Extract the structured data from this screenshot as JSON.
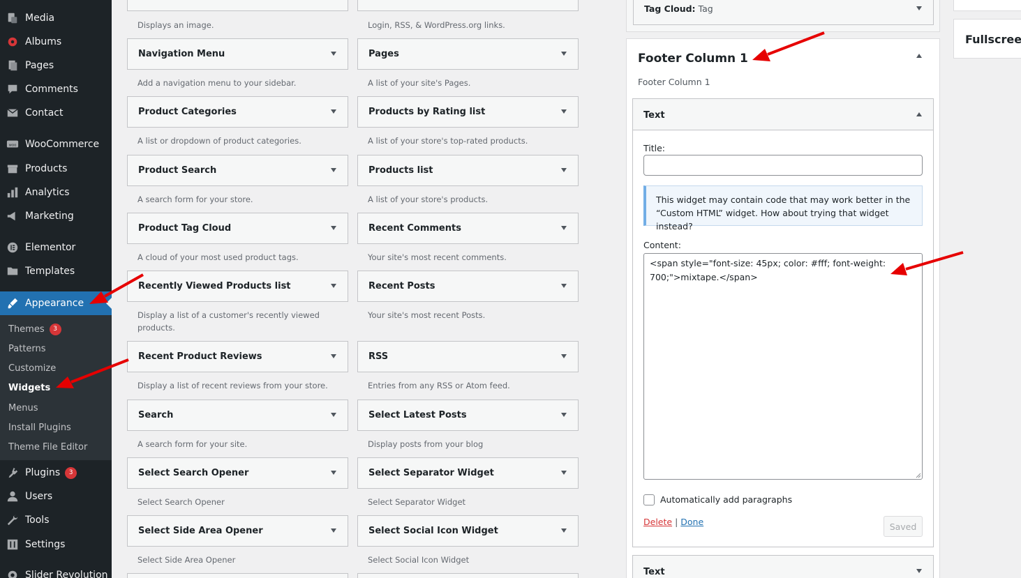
{
  "admin_menu": {
    "items": [
      {
        "label": "Media",
        "icon": "media-icon"
      },
      {
        "label": "Albums",
        "icon": "albums-icon"
      },
      {
        "label": "Pages",
        "icon": "pages-icon"
      },
      {
        "label": "Comments",
        "icon": "comments-icon"
      },
      {
        "label": "Contact",
        "icon": "contact-icon"
      },
      {
        "label": "WooCommerce",
        "icon": "woocommerce-icon"
      },
      {
        "label": "Products",
        "icon": "products-icon"
      },
      {
        "label": "Analytics",
        "icon": "analytics-icon"
      },
      {
        "label": "Marketing",
        "icon": "marketing-icon"
      },
      {
        "label": "Elementor",
        "icon": "elementor-icon"
      },
      {
        "label": "Templates",
        "icon": "templates-icon"
      },
      {
        "label": "Appearance",
        "icon": "appearance-icon"
      },
      {
        "label": "Plugins",
        "icon": "plugins-icon",
        "badge": "3"
      },
      {
        "label": "Users",
        "icon": "users-icon"
      },
      {
        "label": "Tools",
        "icon": "tools-icon"
      },
      {
        "label": "Settings",
        "icon": "settings-icon"
      },
      {
        "label": "Slider Revolution",
        "icon": "slider-revolution-icon"
      }
    ],
    "appearance_submenu": [
      {
        "label": "Themes",
        "badge": "3"
      },
      {
        "label": "Patterns"
      },
      {
        "label": "Customize"
      },
      {
        "label": "Widgets"
      },
      {
        "label": "Menus"
      },
      {
        "label": "Install Plugins"
      },
      {
        "label": "Theme File Editor"
      }
    ]
  },
  "available_widgets": {
    "left": [
      {
        "title": "",
        "desc": "Displays an image."
      },
      {
        "title": "Navigation Menu",
        "desc": "Add a navigation menu to your sidebar."
      },
      {
        "title": "Product Categories",
        "desc": "A list or dropdown of product categories."
      },
      {
        "title": "Product Search",
        "desc": "A search form for your store."
      },
      {
        "title": "Product Tag Cloud",
        "desc": "A cloud of your most used product tags."
      },
      {
        "title": "Recently Viewed Products list",
        "desc": "Display a list of a customer's recently viewed products."
      },
      {
        "title": "Recent Product Reviews",
        "desc": "Display a list of recent reviews from your store."
      },
      {
        "title": "Search",
        "desc": "A search form for your site."
      },
      {
        "title": "Select Search Opener",
        "desc": "Select Search Opener"
      },
      {
        "title": "Select Side Area Opener",
        "desc": "Select Side Area Opener"
      }
    ],
    "right": [
      {
        "title": "",
        "desc": "Login, RSS, & WordPress.org links."
      },
      {
        "title": "Pages",
        "desc": "A list of your site's Pages."
      },
      {
        "title": "Products by Rating list",
        "desc": "A list of your store's top-rated products."
      },
      {
        "title": "Products list",
        "desc": "A list of your store's products."
      },
      {
        "title": "Recent Comments",
        "desc": "Your site's most recent comments."
      },
      {
        "title": "Recent Posts",
        "desc": "Your site's most recent Posts."
      },
      {
        "title": "RSS",
        "desc": "Entries from any RSS or Atom feed."
      },
      {
        "title": "Select Latest Posts",
        "desc": "Display posts from your blog"
      },
      {
        "title": "Select Separator Widget",
        "desc": "Select Separator Widget"
      },
      {
        "title": "Select Social Icon Widget",
        "desc": "Select Social Icon Widget"
      }
    ]
  },
  "sidebar_area": {
    "tag_cloud_widget": {
      "title": "Tag Cloud:",
      "subtitle": "Tag"
    },
    "footer_column": {
      "title": "Footer Column 1",
      "description": "Footer Column 1"
    },
    "text_widget": {
      "header": "Text",
      "title_label": "Title:",
      "title_value": "",
      "notice": "This widget may contain code that may work better in the “Custom HTML” widget. How about trying that widget instead?",
      "content_label": "Content:",
      "content_value": "<span style=\"font-size: 45px; color: #fff; font-weight: 700;\">mixtape.</span>",
      "auto_paragraphs_label": "Automatically add paragraphs",
      "delete_label": "Delete",
      "separator": "|",
      "done_label": "Done",
      "saved_label": "Saved"
    },
    "next_widget_header": "Text"
  },
  "far_right": {
    "fullscreen_label": "Fullscreen"
  },
  "colors": {
    "accent": "#2271b1",
    "admin_bg": "#1d2327",
    "badge": "#d63638",
    "annotation_arrow": "#e60000"
  }
}
